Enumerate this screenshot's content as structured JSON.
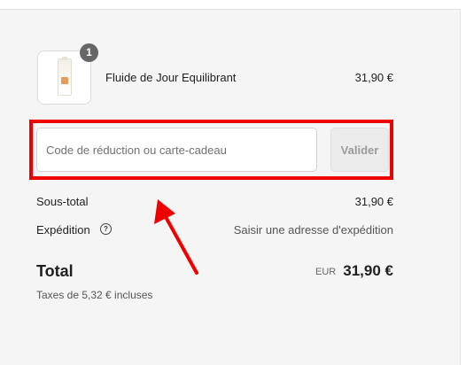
{
  "cart": {
    "item": {
      "name": "Fluide de Jour Equilibrant",
      "price": "31,90 €",
      "quantity": "1",
      "thumbnail_icon": "product-bottle-icon"
    },
    "discount": {
      "placeholder": "Code de réduction ou carte-cadeau",
      "value": "",
      "apply_label": "Valider"
    },
    "subtotal": {
      "label": "Sous-total",
      "value": "31,90 €"
    },
    "shipping": {
      "label": "Expédition",
      "help_icon": "question-circle-icon",
      "value": "Saisir une adresse d'expédition"
    },
    "total": {
      "label": "Total",
      "currency": "EUR",
      "value": "31,90 €",
      "tax_note": "Taxes de 5,32 € incluses"
    }
  },
  "annotation": {
    "highlight_color": "#ee0000",
    "arrow_color": "#ee0000"
  }
}
